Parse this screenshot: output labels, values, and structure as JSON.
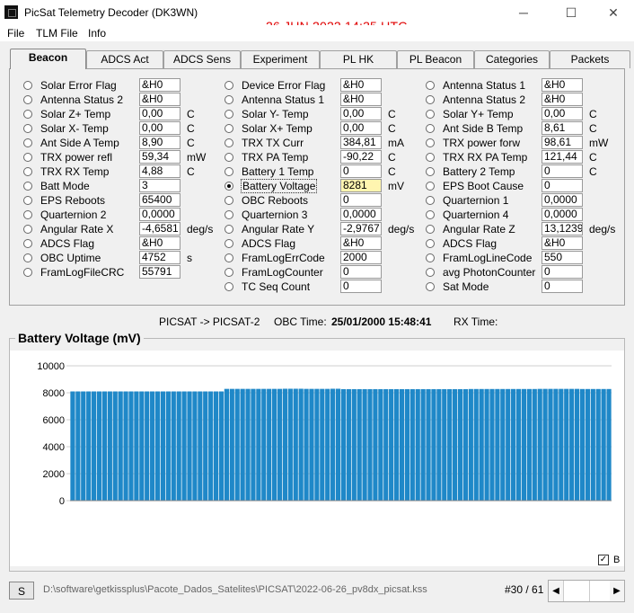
{
  "window": {
    "title": "PicSat Telemetry Decoder (DK3WN)",
    "datetime": "26 JUN 2022   14:35 UTC",
    "minimize": "─",
    "maximize": "☐",
    "close": "✕"
  },
  "menu": [
    "File",
    "TLM File",
    "Info"
  ],
  "tabs": [
    "Beacon",
    "ADCS Act",
    "ADCS Sens",
    "Experiment",
    "PL HK",
    "PL Beacon",
    "Categories",
    "Packets"
  ],
  "active_tab": "Beacon",
  "columns": [
    [
      {
        "label": "Solar Error Flag",
        "value": "&H0",
        "unit": ""
      },
      {
        "label": "Antenna Status 2",
        "value": "&H0",
        "unit": ""
      },
      {
        "label": "Solar Z+ Temp",
        "value": "0,00",
        "unit": "C"
      },
      {
        "label": "Solar X- Temp",
        "value": "0,00",
        "unit": "C"
      },
      {
        "label": "Ant Side A Temp",
        "value": "8,90",
        "unit": "C"
      },
      {
        "label": "TRX power refl",
        "value": "59,34",
        "unit": "mW"
      },
      {
        "label": "TRX RX Temp",
        "value": "4,88",
        "unit": "C"
      },
      {
        "label": "Batt Mode",
        "value": "3",
        "unit": ""
      },
      {
        "label": "EPS Reboots",
        "value": "65400",
        "unit": ""
      },
      {
        "label": "Quarternion 2",
        "value": "0,0000",
        "unit": ""
      },
      {
        "label": "Angular Rate X",
        "value": "-4,6581",
        "unit": "deg/s"
      },
      {
        "label": "ADCS Flag",
        "value": "&H0",
        "unit": ""
      },
      {
        "label": "OBC Uptime",
        "value": "4752",
        "unit": "s"
      },
      {
        "label": "FramLogFileCRC",
        "value": "55791",
        "unit": ""
      }
    ],
    [
      {
        "label": "Device Error Flag",
        "value": "&H0",
        "unit": ""
      },
      {
        "label": "Antenna Status 1",
        "value": "&H0",
        "unit": ""
      },
      {
        "label": "Solar Y- Temp",
        "value": "0,00",
        "unit": "C"
      },
      {
        "label": "Solar X+ Temp",
        "value": "0,00",
        "unit": "C"
      },
      {
        "label": "TRX TX Curr",
        "value": "384,81",
        "unit": "mA"
      },
      {
        "label": "TRX PA Temp",
        "value": "-90,22",
        "unit": "C"
      },
      {
        "label": "Battery 1 Temp",
        "value": "0",
        "unit": "C"
      },
      {
        "label": "Battery Voltage",
        "value": "8281",
        "unit": "mV",
        "selected": true
      },
      {
        "label": "OBC Reboots",
        "value": "0",
        "unit": ""
      },
      {
        "label": "Quarternion 3",
        "value": "0,0000",
        "unit": ""
      },
      {
        "label": "Angular Rate Y",
        "value": "-2,9767",
        "unit": "deg/s"
      },
      {
        "label": "ADCS Flag",
        "value": "&H0",
        "unit": ""
      },
      {
        "label": "FramLogErrCode",
        "value": "2000",
        "unit": ""
      },
      {
        "label": "FramLogCounter",
        "value": "0",
        "unit": ""
      },
      {
        "label": "TC Seq Count",
        "value": "0",
        "unit": ""
      }
    ],
    [
      {
        "label": "Antenna Status 1",
        "value": "&H0",
        "unit": ""
      },
      {
        "label": "Antenna Status 2",
        "value": "&H0",
        "unit": ""
      },
      {
        "label": "Solar Y+ Temp",
        "value": "0,00",
        "unit": "C"
      },
      {
        "label": "Ant Side B Temp",
        "value": "8,61",
        "unit": "C"
      },
      {
        "label": "TRX power forw",
        "value": "98,61",
        "unit": "mW"
      },
      {
        "label": "TRX RX PA Temp",
        "value": "121,44",
        "unit": "C"
      },
      {
        "label": "Battery 2 Temp",
        "value": "0",
        "unit": "C"
      },
      {
        "label": "EPS Boot Cause",
        "value": "0",
        "unit": ""
      },
      {
        "label": "Quarternion 1",
        "value": "0,0000",
        "unit": ""
      },
      {
        "label": "Quarternion 4",
        "value": "0,0000",
        "unit": ""
      },
      {
        "label": "Angular Rate Z",
        "value": "13,1239",
        "unit": "deg/s"
      },
      {
        "label": "ADCS Flag",
        "value": "&H0",
        "unit": ""
      },
      {
        "label": "FramLogLineCode",
        "value": "550",
        "unit": ""
      },
      {
        "label": "avg PhotonCounter",
        "value": "0",
        "unit": ""
      },
      {
        "label": "Sat Mode",
        "value": "0",
        "unit": ""
      }
    ]
  ],
  "info": {
    "route": "PICSAT -> PICSAT-2",
    "obc_label": "OBC Time:",
    "obc_value": "25/01/2000 15:48:41",
    "rx_label": "RX Time:"
  },
  "chart_title": "Battery Voltage (mV)",
  "chart_data": {
    "type": "bar",
    "title": "Battery Voltage (mV)",
    "ylim": [
      0,
      10000
    ],
    "yticks": [
      0,
      2000,
      4000,
      6000,
      8000,
      10000
    ],
    "grid": true,
    "bar_color": "#1f88c8",
    "values": [
      8100,
      8100,
      8100,
      8100,
      8100,
      8100,
      8100,
      8100,
      8100,
      8100,
      8100,
      8100,
      8100,
      8100,
      8100,
      8100,
      8100,
      8100,
      8100,
      8100,
      8100,
      8100,
      8100,
      8100,
      8100,
      8100,
      8100,
      8100,
      8100,
      8290,
      8290,
      8290,
      8290,
      8290,
      8290,
      8290,
      8290,
      8290,
      8290,
      8290,
      8300,
      8300,
      8300,
      8300,
      8290,
      8290,
      8290,
      8290,
      8290,
      8300,
      8300,
      8270,
      8270,
      8270,
      8270,
      8270,
      8270,
      8270,
      8270,
      8270,
      8270,
      8270,
      8270,
      8270,
      8270,
      8270,
      8270,
      8270,
      8270,
      8270,
      8270,
      8270,
      8270,
      8270,
      8270,
      8280,
      8280,
      8280,
      8280,
      8280,
      8280,
      8280,
      8280,
      8280,
      8280,
      8280,
      8280,
      8280,
      8290,
      8290,
      8290,
      8290,
      8290,
      8290,
      8290,
      8290,
      8280,
      8280,
      8280,
      8280,
      8280,
      8280
    ]
  },
  "legend": {
    "checked": "✓",
    "label": "B"
  },
  "status": {
    "button": "S",
    "file": "D:\\software\\getkissplus\\Pacote_Dados_Satelites\\PICSAT\\2022-06-26_pv8dx_picsat.kss",
    "counter": "#30 / 61",
    "scroll_left": "◀",
    "scroll_right": "▶"
  }
}
